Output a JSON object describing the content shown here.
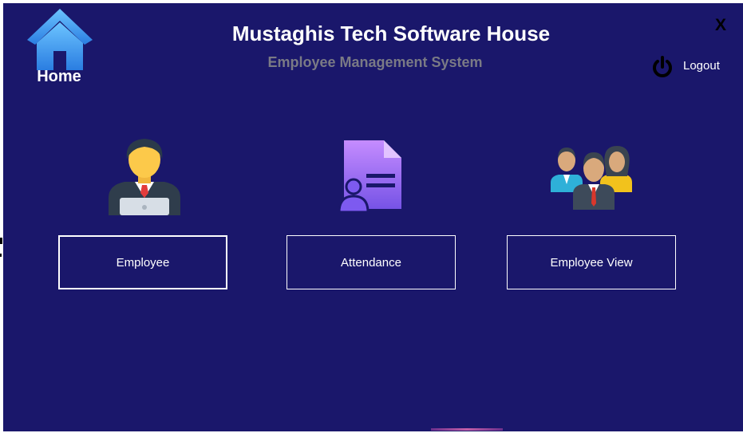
{
  "window": {
    "title": "Mustaghis Tech Software House",
    "subtitle": "Employee Management System",
    "close_label": "X"
  },
  "home": {
    "label": "Home",
    "icon": "home-icon"
  },
  "logout": {
    "label": "Logout",
    "icon": "power-icon"
  },
  "cards": [
    {
      "label": "Employee",
      "icon": "employee-icon"
    },
    {
      "label": "Attendance",
      "icon": "attendance-icon"
    },
    {
      "label": "Employee View",
      "icon": "team-icon"
    }
  ],
  "colors": {
    "background": "#1a176b",
    "title": "#ffffff",
    "subtitle": "#7a7a85",
    "button_border": "#ffffff"
  }
}
